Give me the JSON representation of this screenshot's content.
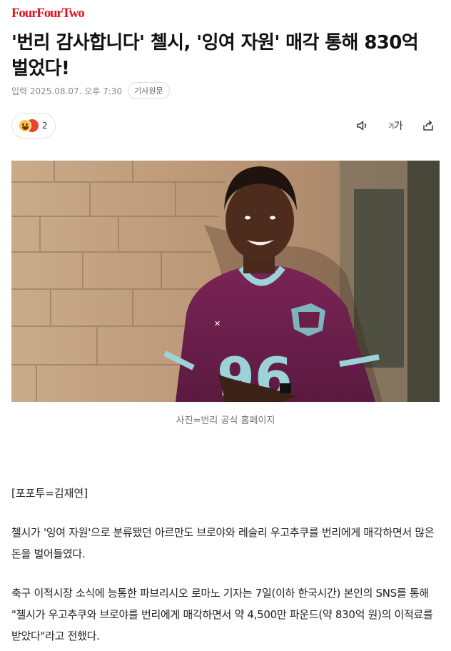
{
  "header": {
    "brand": "FourFourTwo"
  },
  "article": {
    "title": "'번리 감사합니다' 첼시, '잉여 자원' 매각 통해 830억 벌었다!",
    "meta": {
      "date_label": "입력 2025.08.07. 오후 7:30",
      "source_button": "기사원문"
    },
    "reactions": {
      "count": "2",
      "icons": [
        "laughing-face-icon",
        "angry-face-icon"
      ]
    },
    "tools": [
      "speaker-icon",
      "font-size-icon",
      "share-icon"
    ],
    "font_size_label": "가",
    "photo_caption": "사진=번리 공식 홈페이지",
    "jersey_number": "96",
    "byline": "[포포투=김재연]",
    "paragraphs": [
      "첼시가 '잉여 자원'으로 분류됐던 아르만도 브로야와 레슬리 우고추쿠를 번리에게 매각하면서 많은 돈을 벌어들였다.",
      "축구 이적시장 소식에 능통한 파브리시오 로마노 기자는 7일(이하 한국시간) 본인의 SNS를 통해 \"첼시가 우고추쿠와 브로야를 번리에게 매각하면서 약 4,500만 파운드(약 830억 원)의 이적료를 받았다\"라고 전했다."
    ]
  }
}
